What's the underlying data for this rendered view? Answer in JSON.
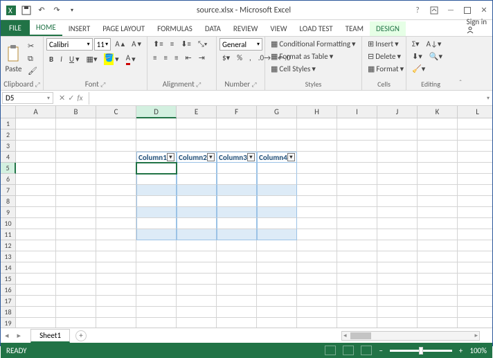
{
  "titlebar": {
    "title": "source.xlsx - Microsoft Excel"
  },
  "tabs": {
    "file": "FILE",
    "items": [
      "HOME",
      "INSERT",
      "PAGE LAYOUT",
      "FORMULAS",
      "DATA",
      "REVIEW",
      "VIEW",
      "LOAD TEST",
      "TEAM"
    ],
    "contextual": "DESIGN",
    "active": "HOME",
    "signin": "Sign in"
  },
  "ribbon": {
    "clipboard": {
      "paste": "Paste",
      "label": "Clipboard"
    },
    "font": {
      "name": "Calibri",
      "size": "11",
      "label": "Font"
    },
    "alignment": {
      "label": "Alignment"
    },
    "number": {
      "format": "General",
      "label": "Number"
    },
    "styles": {
      "cond": "Conditional Formatting",
      "table": "Format as Table",
      "cell": "Cell Styles",
      "label": "Styles"
    },
    "cells": {
      "insert": "Insert",
      "delete": "Delete",
      "format": "Format",
      "label": "Cells"
    },
    "editing": {
      "label": "Editing"
    }
  },
  "formula_bar": {
    "name_box": "D5",
    "fx": "fx"
  },
  "grid": {
    "columns": [
      "A",
      "B",
      "C",
      "D",
      "E",
      "F",
      "G",
      "H",
      "I",
      "J",
      "K",
      "L"
    ],
    "rows": [
      1,
      2,
      3,
      4,
      5,
      6,
      7,
      8,
      9,
      10,
      11,
      12,
      13,
      14,
      15,
      16,
      17,
      18,
      19
    ],
    "active_cell": "D5",
    "active_col": "D",
    "active_row": 5,
    "table": {
      "header_row": 4,
      "cols": [
        "D",
        "E",
        "F",
        "G"
      ],
      "headers": [
        "Column1",
        "Column2",
        "Column3",
        "Column4"
      ],
      "body_rows": [
        5,
        6,
        7,
        8,
        9,
        10,
        11
      ],
      "banded_rows": [
        7,
        9,
        11
      ]
    }
  },
  "sheets": {
    "active": "Sheet1"
  },
  "status": {
    "mode": "READY",
    "zoom": "100%"
  }
}
